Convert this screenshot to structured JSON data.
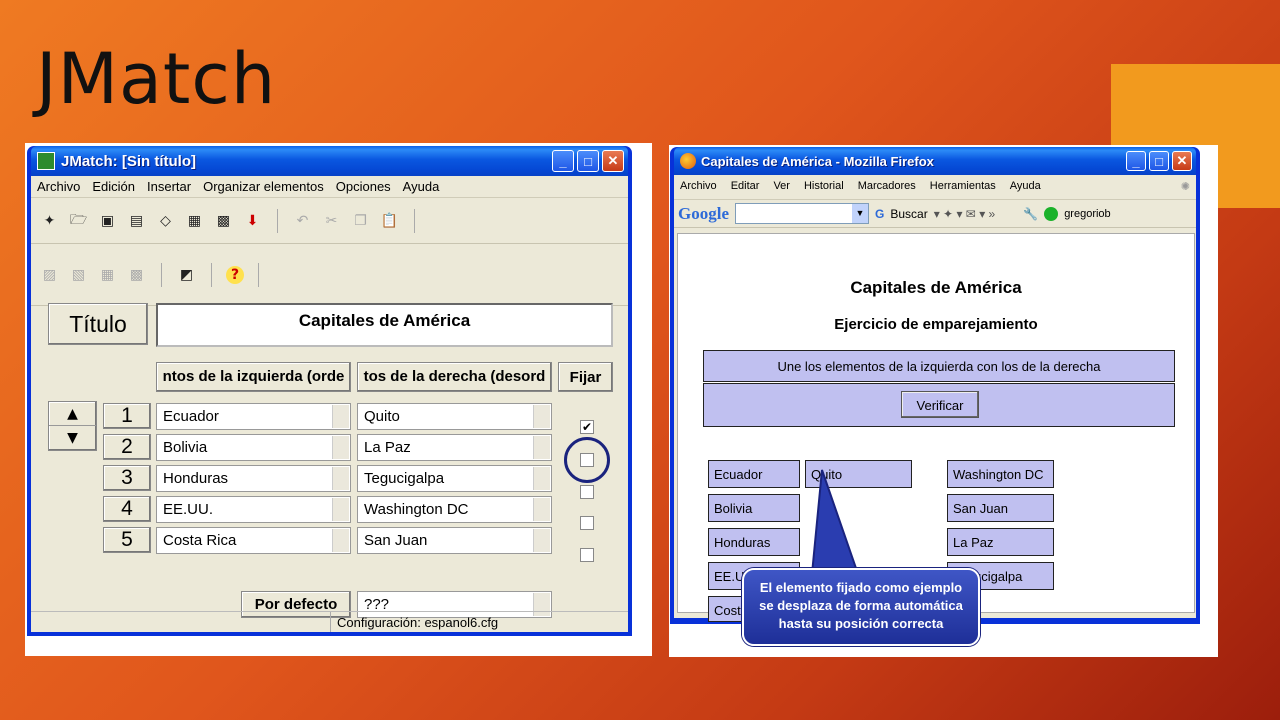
{
  "slide": {
    "title": "JMatch"
  },
  "jmatch": {
    "window_title": "JMatch: [Sin título]",
    "menu": [
      "Archivo",
      "Edición",
      "Insertar",
      "Organizar elementos",
      "Opciones",
      "Ayuda"
    ],
    "title_button": "Título",
    "title_value": "Capitales de América",
    "left_header": "ntos de la izquierda (orde",
    "right_header": "tos de la derecha (desord",
    "fix_button": "Fijar",
    "rows": [
      {
        "num": "1",
        "left": "Ecuador",
        "right": "Quito",
        "fixed": true
      },
      {
        "num": "2",
        "left": "Bolivia",
        "right": "La Paz",
        "fixed": false
      },
      {
        "num": "3",
        "left": "Honduras",
        "right": "Tegucigalpa",
        "fixed": false
      },
      {
        "num": "4",
        "left": "EE.UU.",
        "right": "Washington DC",
        "fixed": false
      },
      {
        "num": "5",
        "left": "Costa Rica",
        "right": "San Juan",
        "fixed": false
      }
    ],
    "default_button": "Por defecto",
    "default_value": "???",
    "status": "Configuración: espanol6.cfg"
  },
  "firefox": {
    "window_title": "Capitales de América - Mozilla Firefox",
    "menu": [
      "Archivo",
      "Editar",
      "Ver",
      "Historial",
      "Marcadores",
      "Herramientas",
      "Ayuda"
    ],
    "google_label": "Google",
    "search_button": "Buscar",
    "user": "gregoriob",
    "page_title": "Capitales de América",
    "page_subtitle": "Ejercicio de emparejamiento",
    "instructions": "Une los elementos de la izquierda con los de la derecha",
    "verify_button": "Verificar",
    "left_items": [
      "Ecuador",
      "Bolivia",
      "Honduras",
      "EE.UU.",
      "Costa"
    ],
    "placed_item": "Quito",
    "right_items": [
      "Washington DC",
      "San Juan",
      "La Paz",
      "Tegucigalpa"
    ]
  },
  "callout": {
    "line1": "El elemento fijado como ejemplo",
    "line2": "se desplaza de forma automática",
    "line3": "hasta su posición correcta"
  },
  "colors": {
    "accent": "#f29a1e",
    "xp_blue": "#0831d9",
    "tile": "#c0c0f0",
    "callout": "#1e2f98"
  }
}
